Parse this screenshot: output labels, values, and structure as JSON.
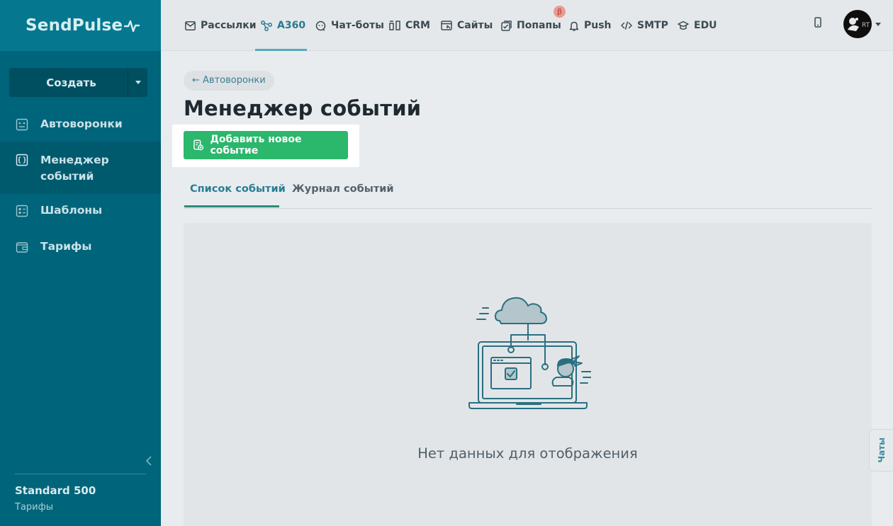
{
  "brand": {
    "name": "SendPulse"
  },
  "sidebar": {
    "create_label": "Создать",
    "items": [
      {
        "label": "Автоворонки",
        "icon": "funnel-icon"
      },
      {
        "label": "Менеджер событий",
        "icon": "code-brackets-icon",
        "active": true
      },
      {
        "label": "Шаблоны",
        "icon": "templates-icon"
      },
      {
        "label": "Тарифы",
        "icon": "wallet-icon"
      }
    ],
    "plan_name": "Standard 500",
    "plan_link": "Тарифы"
  },
  "topnav": {
    "items": [
      {
        "label": "Рассылки",
        "icon": "envelope-icon"
      },
      {
        "label": "А360",
        "icon": "flow-icon",
        "active": true
      },
      {
        "label": "Чат-боты",
        "icon": "chat-bot-icon"
      },
      {
        "label": "CRM",
        "icon": "crm-icon"
      },
      {
        "label": "Сайты",
        "icon": "site-icon"
      },
      {
        "label": "Попапы",
        "icon": "popup-icon"
      },
      {
        "label": "Push",
        "icon": "bell-icon"
      },
      {
        "label": "SMTP",
        "icon": "code-icon"
      },
      {
        "label": "EDU",
        "icon": "graduation-cap-icon"
      }
    ],
    "beta_badge": "β",
    "avatar_text": "RT"
  },
  "main": {
    "back_link": "← Автоворонки",
    "title": "Менеджер событий",
    "add_button": "Добавить новое событие",
    "tabs": [
      {
        "label": "Список событий",
        "active": true
      },
      {
        "label": "Журнал событий"
      }
    ],
    "empty_text": "Нет данных для отображения"
  },
  "chat_tab": "Чаты",
  "colors": {
    "sidebar_bg": "#00647a",
    "accent_green": "#2bb76c",
    "accent_teal": "#267a91"
  }
}
